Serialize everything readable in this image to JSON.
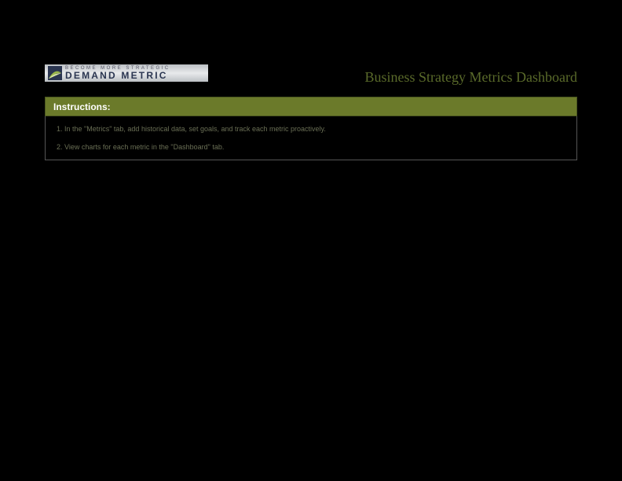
{
  "logo": {
    "tagline": "Become More Strategic",
    "brand": "Demand Metric"
  },
  "title": "Business Strategy Metrics Dashboard",
  "instructions": {
    "header": "Instructions:",
    "items": [
      "1. In the \"Metrics\" tab, add historical data, set goals, and track each metric proactively.",
      "2.  View charts for each metric in the \"Dashboard\" tab."
    ]
  }
}
